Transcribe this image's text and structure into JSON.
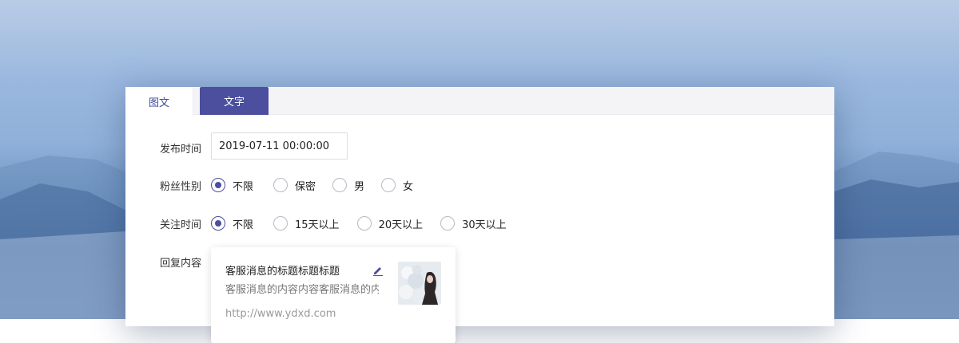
{
  "tabs": [
    {
      "label": "图文"
    },
    {
      "label": "文字"
    }
  ],
  "form": {
    "publish_time": {
      "label": "发布时间",
      "value": "2019-07-11 00:00:00"
    },
    "fan_gender": {
      "label": "粉丝性别",
      "options": [
        "不限",
        "保密",
        "男",
        "女"
      ],
      "selected": "不限"
    },
    "follow_time": {
      "label": "关注时间",
      "options": [
        "不限",
        "15天以上",
        "20天以上",
        "30天以上"
      ],
      "selected": "不限"
    },
    "reply_content": {
      "label": "回复内容",
      "card": {
        "title": "客服消息的标题标题标题",
        "description": "客服消息的内容内容客服消息的内",
        "url": "http://www.ydxd.com",
        "edit_icon": "edit-pencil-icon",
        "thumbnail": "article-thumbnail-image"
      }
    }
  },
  "colors": {
    "accent": "#4c4f9e",
    "active_tab_text": "#3b4a9c"
  }
}
